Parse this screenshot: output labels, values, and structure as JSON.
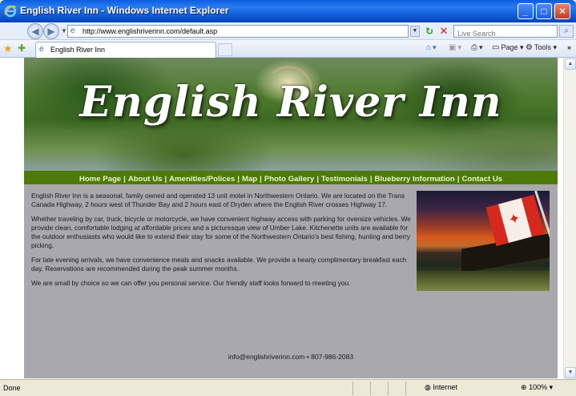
{
  "window": {
    "title": "English River Inn - Windows Internet Explorer",
    "minimize_label": "_",
    "maximize_label": "□",
    "close_label": "✕"
  },
  "address_bar": {
    "url": "http://www.englishriverinn.com/default.asp",
    "search_placeholder": "Live Search"
  },
  "tab_bar": {
    "active_tab_label": "English River Inn",
    "commands": {
      "page_label": "Page",
      "tools_label": "Tools"
    }
  },
  "site": {
    "title": "English River Inn",
    "nav": [
      "Home Page",
      "About Us",
      "Amenities/Polices",
      "Map",
      "Photo Gallery",
      "Testimonials",
      "Blueberry Information",
      "Contact Us"
    ],
    "paragraphs": [
      "English River Inn is a seasonal, family owned and operated 13 unit motel in Northwestern Ontario. We are located on the Trans Canada Highway, 2 hours west of Thunder Bay and 2 hours east of Dryden where the English River crosses Highway 17.",
      "Whether traveling by car, truck, bicycle or motorcycle, we have convenient highway access with parking for oversize vehicles.  We provide clean, comfortable lodging at affordable prices and a picturesque view of Umber Lake. Kitchenette units are available for the outdoor enthusiasts who would like to extend their stay for some of the Northwestern Ontario's best fishing, hunting and berry picking.",
      "For late evening arrivals, we have convenience meals and snacks available. We provide a hearty complimentary breakfast each day. Reservations are recommended during the peak summer months.",
      "We are small by choice so we can offer you personal service. Our friendly staff looks forward to meeting you."
    ],
    "contact": "info@englishriverinn.com • 807-986-2083"
  },
  "status_bar": {
    "text": "Done",
    "zone": "Internet",
    "zoom": "100%"
  },
  "colors": {
    "nav_background": "#4d7a0a",
    "nav_text": "#e9f6c6",
    "page_background": "#a8a8ad",
    "titlebar_blue": "#0a5ce0"
  }
}
